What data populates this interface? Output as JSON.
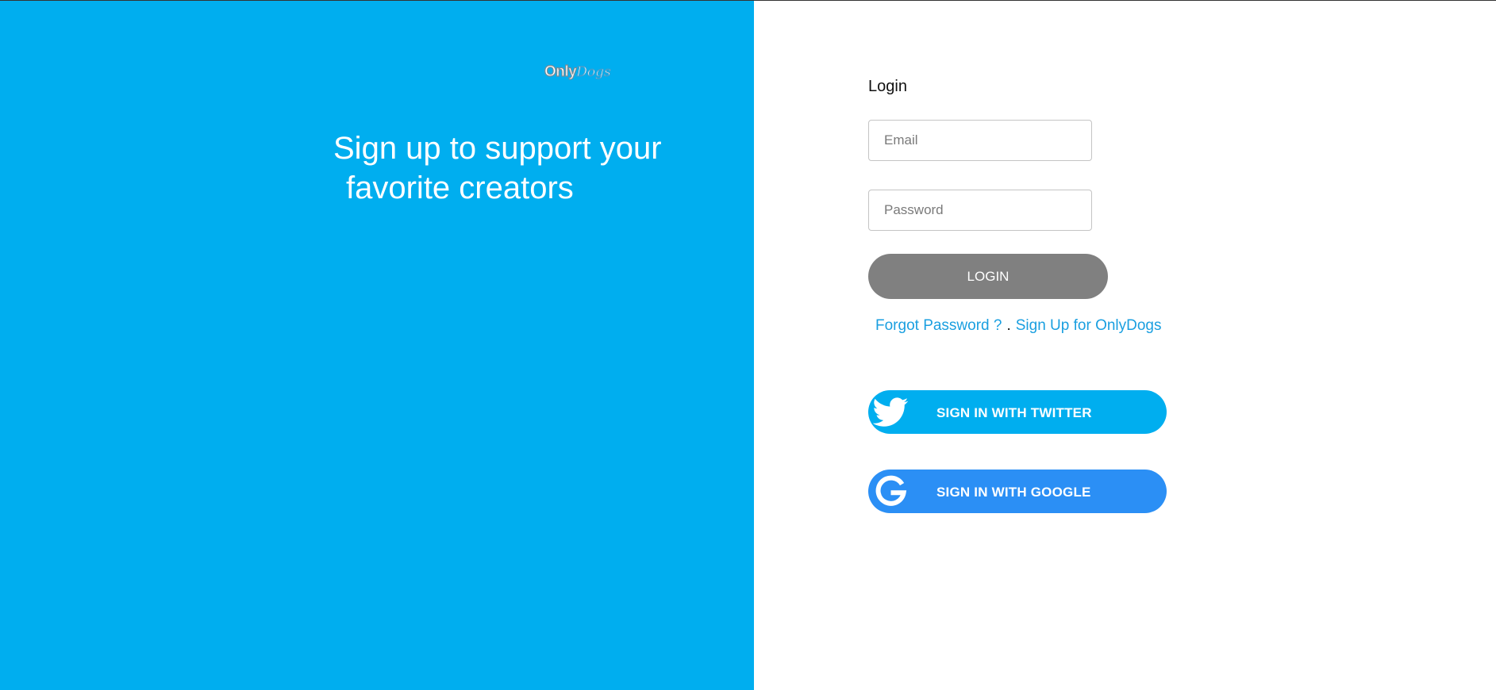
{
  "brand": {
    "logo_part1": "Only",
    "logo_part2": "Dogs",
    "tagline_line1": "Sign up to support your",
    "tagline_line2": "favorite creators"
  },
  "login": {
    "title": "Login",
    "email_placeholder": "Email",
    "password_placeholder": "Password",
    "login_button": "LOGIN",
    "forgot_link": "Forgot Password ?",
    "separator": ".",
    "signup_link": "Sign Up for OnlyDogs"
  },
  "social": {
    "twitter_label": "SIGN IN WITH TWITTER",
    "twitter_icon": "twitter-bird-icon",
    "google_label": "SIGN IN WITH GOOGLE",
    "google_icon": "google-g-icon"
  },
  "colors": {
    "left_panel": "#00aeef",
    "login_button": "#808080",
    "link": "#1a9fe0",
    "twitter": "#00aeef",
    "google": "#2b8ff5"
  }
}
